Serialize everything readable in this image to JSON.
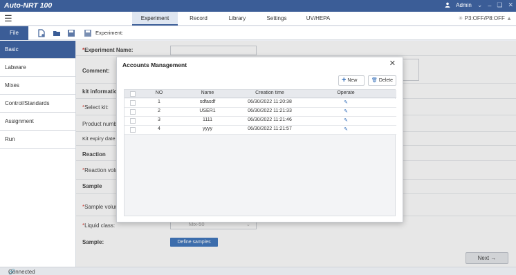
{
  "app": {
    "title": "Auto-NRT 100",
    "user": "Admin"
  },
  "menu": {
    "tabs": [
      {
        "label": "Experiment"
      },
      {
        "label": "Record"
      },
      {
        "label": "Library"
      },
      {
        "label": "Settings"
      },
      {
        "label": "UV/HEPA"
      }
    ],
    "status": "P3:OFF/P8:OFF"
  },
  "toolbar": {
    "file_label": "File",
    "experiment_label": "Experiment:"
  },
  "sidebar": {
    "items": [
      {
        "label": "Basic"
      },
      {
        "label": "Labware"
      },
      {
        "label": "Mixes"
      },
      {
        "label": "Control/Standards"
      },
      {
        "label": "Assignment"
      },
      {
        "label": "Run"
      }
    ]
  },
  "form": {
    "experiment_name_label": "Experiment Name:",
    "comment_label": "Comment:",
    "kit_info_label": "kit informatic",
    "select_kit_label": "Select kit:",
    "product_number_label": "Product numb",
    "kit_expiry_label": "Kit expiry date",
    "reaction_label": "Reaction",
    "reaction_volume_label": "Reaction volu",
    "sample_label": "Sample",
    "sample_volume_label": "Sample volur",
    "liquid_class_label": "Liquid class:",
    "liquid_class_value": "Mix-50",
    "samples_label": "Sample:",
    "required_mark": "*",
    "define_samples_button": "Define samples",
    "next_button": "Next"
  },
  "modal": {
    "title": "Accounts Management",
    "new_button": "New",
    "delete_button": "Delete",
    "columns": {
      "no": "NO",
      "name": "Name",
      "created": "Creation time",
      "operate": "Operate"
    },
    "rows": [
      {
        "no": "1",
        "name": "sdfasdf",
        "created": "06/30/2022 11:20:38"
      },
      {
        "no": "2",
        "name": "USER1",
        "created": "06/30/2022 11:21:33"
      },
      {
        "no": "3",
        "name": "1111",
        "created": "06/30/2022 11:21:46"
      },
      {
        "no": "4",
        "name": "yyyy",
        "created": "06/30/2022 11:21:57"
      }
    ]
  },
  "statusbar": {
    "text": "Connected"
  },
  "colors": {
    "accent": "#3b5d97",
    "primary_button": "#2f6bb8",
    "required": "#d93025"
  }
}
